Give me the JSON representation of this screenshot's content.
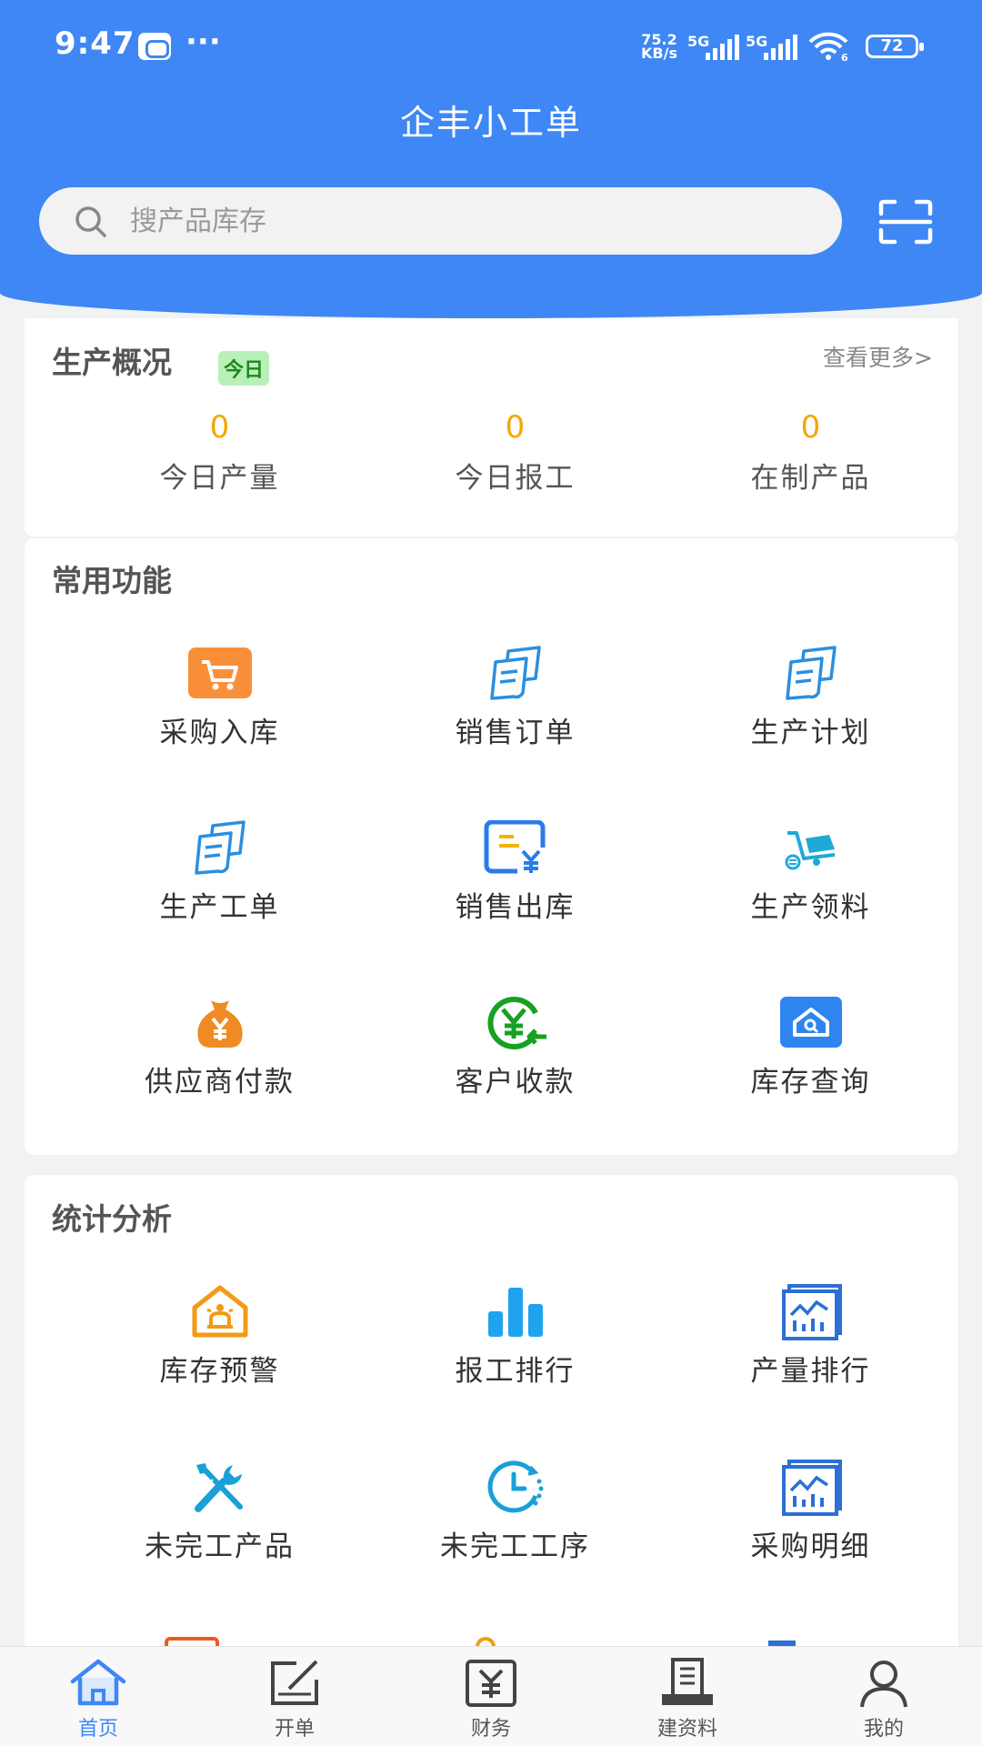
{
  "status_bar": {
    "time": "9:47",
    "dots": "···",
    "speed_value": "75.2",
    "speed_unit": "KB/s",
    "net1": "5G",
    "net2": "5G",
    "wifi_sub": "6",
    "battery": "72"
  },
  "header": {
    "title": "企丰小工单"
  },
  "search": {
    "placeholder": "搜产品库存"
  },
  "overview": {
    "title": "生产概况",
    "badge": "今日",
    "more": "查看更多>",
    "stats": [
      {
        "value": "0",
        "label": "今日产量"
      },
      {
        "value": "0",
        "label": "今日报工"
      },
      {
        "value": "0",
        "label": "在制产品"
      }
    ]
  },
  "common": {
    "title": "常用功能",
    "items": [
      {
        "label": "采购入库",
        "icon": "cart-icon"
      },
      {
        "label": "销售订单",
        "icon": "document-icon"
      },
      {
        "label": "生产计划",
        "icon": "document-icon"
      },
      {
        "label": "生产工单",
        "icon": "document-icon"
      },
      {
        "label": "销售出库",
        "icon": "invoice-yen-icon"
      },
      {
        "label": "生产领料",
        "icon": "trolley-icon"
      },
      {
        "label": "供应商付款",
        "icon": "money-bag-icon"
      },
      {
        "label": "客户收款",
        "icon": "yen-receive-icon"
      },
      {
        "label": "库存查询",
        "icon": "house-search-icon"
      }
    ]
  },
  "analysis": {
    "title": "统计分析",
    "items": [
      {
        "label": "库存预警",
        "icon": "house-alarm-icon"
      },
      {
        "label": "报工排行",
        "icon": "bar-chart-icon"
      },
      {
        "label": "产量排行",
        "icon": "chart-board-icon"
      },
      {
        "label": "未完工产品",
        "icon": "tools-icon"
      },
      {
        "label": "未完工工序",
        "icon": "clock-icon"
      },
      {
        "label": "采购明细",
        "icon": "chart-board-icon"
      }
    ]
  },
  "tabbar": {
    "items": [
      {
        "label": "首页",
        "icon": "home-icon",
        "active": true
      },
      {
        "label": "开单",
        "icon": "edit-icon",
        "active": false
      },
      {
        "label": "财务",
        "icon": "yen-box-icon",
        "active": false
      },
      {
        "label": "建资料",
        "icon": "register-icon",
        "active": false
      },
      {
        "label": "我的",
        "icon": "user-icon",
        "active": false
      }
    ]
  },
  "colors": {
    "primary": "#3e87f5",
    "orange": "#f4a700",
    "badge_bg": "#b9f0b9",
    "badge_text": "#1b8a1b"
  }
}
